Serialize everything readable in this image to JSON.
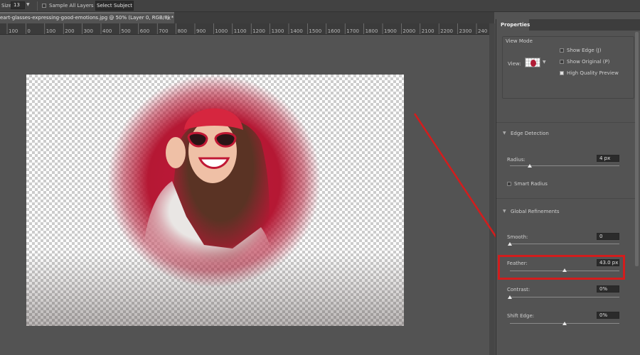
{
  "options_bar": {
    "size_label": "Size:",
    "size_value": "13",
    "sample_all_layers_label": "Sample All Layers",
    "select_subject_label": "Select Subject"
  },
  "document_tab": {
    "title": "eart-glasses-expressing-good-emotions.jpg @ 50% (Layer 0, RGB/8) *",
    "close": "×"
  },
  "ruler": {
    "ticks": [
      "100",
      "0",
      "100",
      "200",
      "300",
      "400",
      "500",
      "600",
      "700",
      "800",
      "900",
      "1000",
      "1100",
      "1200",
      "1300",
      "1400",
      "1500",
      "1600",
      "1700",
      "1800",
      "1900",
      "2000",
      "2100",
      "2200",
      "2300",
      "240"
    ]
  },
  "properties": {
    "tab_label": "Properties",
    "view_mode": {
      "header": "View Mode",
      "view_label": "View:",
      "show_edge_label": "Show Edge (J)",
      "show_original_label": "Show Original (P)",
      "high_quality_label": "High Quality Preview",
      "show_edge_checked": false,
      "show_original_checked": false,
      "high_quality_checked": true
    },
    "edge_detection": {
      "header": "Edge Detection",
      "radius_label": "Radius:",
      "radius_value": "4 px",
      "radius_fraction": 0.18,
      "smart_radius_label": "Smart Radius",
      "smart_radius_checked": false
    },
    "global_refinements": {
      "header": "Global Refinements",
      "smooth_label": "Smooth:",
      "smooth_value": "0",
      "smooth_fraction": 0.0,
      "feather_label": "Feather:",
      "feather_value": "43.0 px",
      "feather_fraction": 0.5,
      "contrast_label": "Contrast:",
      "contrast_value": "0%",
      "contrast_fraction": 0.0,
      "shift_edge_label": "Shift Edge:",
      "shift_edge_value": "0%",
      "shift_edge_fraction": 0.5
    }
  },
  "colors": {
    "highlight": "#d21d1d",
    "annotation_arrow": "#d21d1d",
    "subject_background": "#b51834"
  }
}
